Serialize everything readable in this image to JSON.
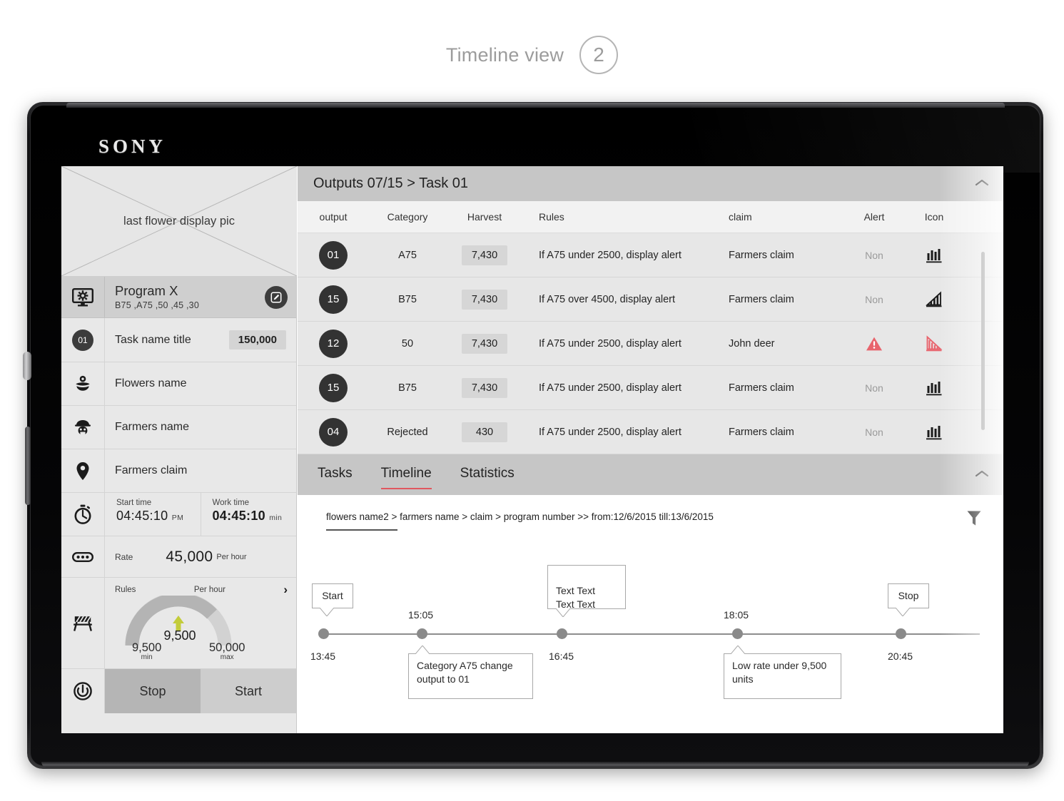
{
  "page": {
    "title": "Timeline view",
    "step_badge": "2"
  },
  "device": {
    "brand": "SONY"
  },
  "sidebar": {
    "photo_placeholder": "last flower display pic",
    "program": {
      "title": "Program X",
      "subtitle": "B75 ,A75 ,50 ,45 ,30",
      "edit_icon": "edit-icon",
      "icon": "monitor-settings-icon"
    },
    "task": {
      "badge": "01",
      "label": "Task name title",
      "value": "150,000"
    },
    "items": [
      {
        "icon": "flower-icon",
        "label": "Flowers name"
      },
      {
        "icon": "farmer-icon",
        "label": "Farmers name"
      },
      {
        "icon": "location-pin-icon",
        "label": "Farmers claim"
      }
    ],
    "time": {
      "icon": "stopwatch-icon",
      "start_caption": "Start time",
      "start_value": "04:45:10",
      "start_unit": "PM",
      "work_caption": "Work time",
      "work_value": "04:45:10",
      "work_unit": "min"
    },
    "rate": {
      "icon": "chain-icon",
      "caption": "Rate",
      "value": "45,000",
      "unit": "Per hour"
    },
    "rules": {
      "icon": "barrier-icon",
      "caption": "Rules",
      "per_hour": "Per hour",
      "chevron": "chevron-right-icon",
      "current": "9,500",
      "min_value": "9,500",
      "min_label": "min",
      "max_value": "50,000",
      "max_label": "max",
      "arrow_color": "#c3cc3a",
      "arc_fill_color": "#b4b4b4",
      "arc_track_color": "#d2d2d2"
    },
    "power": {
      "icon": "power-icon",
      "stop_label": "Stop",
      "start_label": "Start"
    }
  },
  "outputs": {
    "header_title": "Outputs  07/15 > Task 01",
    "collapse_icon": "chevron-up-icon",
    "columns": [
      "output",
      "Category",
      "Harvest",
      "Rules",
      "claim",
      "Alert",
      "Icon"
    ],
    "rows": [
      {
        "output": "01",
        "category": "A75",
        "harvest": "7,430",
        "rules": "If A75 under 2500, display alert",
        "claim": "Farmers claim",
        "alert": "Non",
        "alert_state": "none",
        "icon": "bar-chart-icon"
      },
      {
        "output": "15",
        "category": "B75",
        "harvest": "7,430",
        "rules": "If A75 over 4500, display alert",
        "claim": "Farmers claim",
        "alert": "Non",
        "alert_state": "none",
        "icon": "chart-up-icon"
      },
      {
        "output": "12",
        "category": "50",
        "harvest": "7,430",
        "rules": "If A75 under 2500, display alert",
        "claim": "John deer",
        "alert": "",
        "alert_state": "alert",
        "icon": "chart-down-icon"
      },
      {
        "output": "15",
        "category": "B75",
        "harvest": "7,430",
        "rules": "If A75 under 2500, display alert",
        "claim": "Farmers claim",
        "alert": "Non",
        "alert_state": "none",
        "icon": "bar-chart-icon"
      },
      {
        "output": "04",
        "category": "Rejected",
        "harvest": "430",
        "rules": "If A75 under 2500, display alert",
        "claim": "Farmers claim",
        "alert": "Non",
        "alert_state": "none",
        "icon": "bar-chart-icon"
      }
    ],
    "alert_color": "#e8646d"
  },
  "tabs": {
    "items": [
      {
        "label": "Tasks",
        "active": false
      },
      {
        "label": "Timeline",
        "active": true
      },
      {
        "label": "Statistics",
        "active": false
      }
    ],
    "active_underline_color": "#e0585f",
    "collapse_icon": "chevron-up-icon"
  },
  "timeline": {
    "breadcrumb": "flowers name2 > farmers name > claim > program number >> from:12/6/2015 till:13/6/2015",
    "filter_icon": "filter-icon",
    "points": [
      {
        "time": "13:45",
        "time_pos": "below",
        "callout": "Start",
        "callout_pos": "above"
      },
      {
        "time": "15:05",
        "time_pos": "above",
        "callout": "Category A75 change output to 01",
        "callout_pos": "below"
      },
      {
        "time": "16:45",
        "time_pos": "below",
        "callout": "Text Text\nText Text",
        "callout_pos": "above"
      },
      {
        "time": "18:05",
        "time_pos": "above",
        "callout": "Low rate under 9,500 units",
        "callout_pos": "below"
      },
      {
        "time": "20:45",
        "time_pos": "below",
        "callout": "Stop",
        "callout_pos": "above"
      }
    ]
  }
}
